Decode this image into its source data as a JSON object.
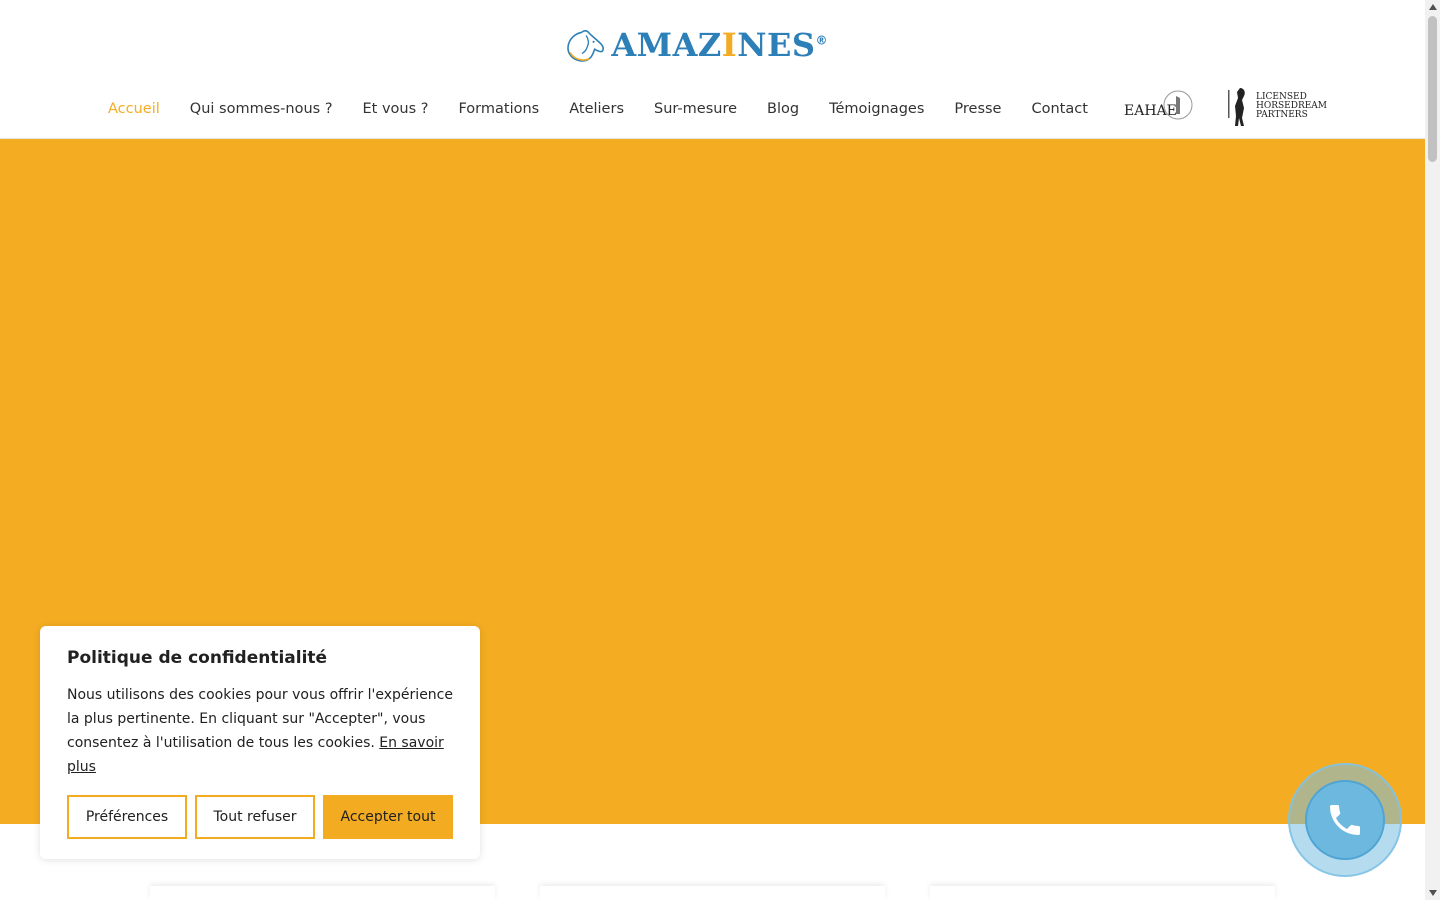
{
  "brand": {
    "name_prefix": "AMAZ",
    "name_i": "I",
    "name_suffix": "NES",
    "registered": "®",
    "accent_color": "#f3ac22",
    "logo_color": "#2d7fb8"
  },
  "nav": {
    "items": [
      {
        "label": "Accueil",
        "active": true
      },
      {
        "label": "Qui sommes-nous ?"
      },
      {
        "label": "Et vous ?"
      },
      {
        "label": "Formations"
      },
      {
        "label": "Ateliers"
      },
      {
        "label": "Sur-mesure"
      },
      {
        "label": "Blog"
      },
      {
        "label": "Témoignages"
      },
      {
        "label": "Presse"
      },
      {
        "label": "Contact"
      }
    ],
    "badges": {
      "eahae": "EAHAE",
      "horsedream_line1": "LICENSED",
      "horsedream_line2": "HORSEDREAM",
      "horsedream_line3": "PARTNERS"
    }
  },
  "hero": {
    "background_color": "#f4ac22"
  },
  "cookie": {
    "title": "Politique de confidentialité",
    "text": "Nous utilisons des cookies pour vous offrir l'expérience la plus pertinente. En cliquant sur \"Accepter\", vous consentez à l'utilisation de tous les cookies.",
    "link": "En savoir plus",
    "buttons": {
      "preferences": "Préférences",
      "reject": "Tout refuser",
      "accept": "Accepter tout"
    }
  },
  "phone_widget": {
    "icon": "phone-icon",
    "color": "#6db8de"
  }
}
